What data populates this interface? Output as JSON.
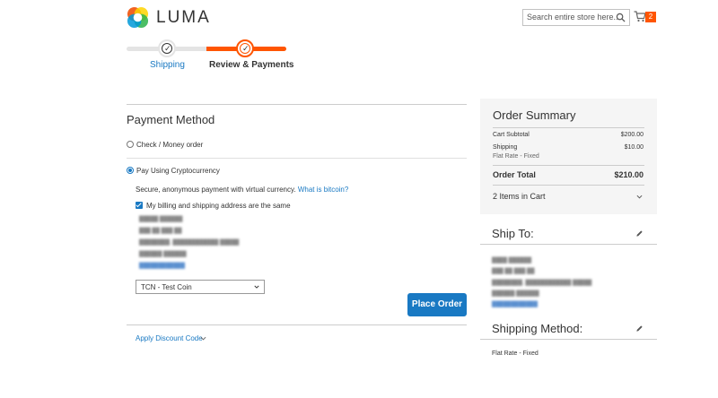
{
  "header": {
    "logo_text": "LUMA",
    "search_placeholder": "Search entire store here...",
    "cart_count": "2"
  },
  "progress": {
    "steps": [
      {
        "label": "Shipping",
        "state": "complete"
      },
      {
        "label": "Review & Payments",
        "state": "active"
      }
    ]
  },
  "payment": {
    "title": "Payment Method",
    "option1": "Check / Money order",
    "option2": "Pay Using Cryptocurrency",
    "description": "Secure, anonymous payment with virtual currency.",
    "what_is_link": "What is bitcoin?",
    "same_address_label": "My billing and shipping address are the same",
    "currency_selected": "TCN - Test Coin",
    "place_order": "Place Order",
    "discount_label": "Apply Discount Code"
  },
  "summary": {
    "title": "Order Summary",
    "cart_subtotal_label": "Cart Subtotal",
    "cart_subtotal_value": "$200.00",
    "shipping_label": "Shipping",
    "shipping_value": "$10.00",
    "shipping_sub": "Flat Rate - Fixed",
    "order_total_label": "Order Total",
    "order_total_value": "$210.00",
    "items_in_cart": "2 Items in Cart"
  },
  "ship_to": {
    "title": "Ship To:"
  },
  "shipping_method": {
    "title": "Shipping Method:",
    "value": "Flat Rate - Fixed"
  },
  "colors": {
    "accent_orange": "#ff5501",
    "link_blue": "#1979c3",
    "summary_bg": "#f5f5f5"
  }
}
